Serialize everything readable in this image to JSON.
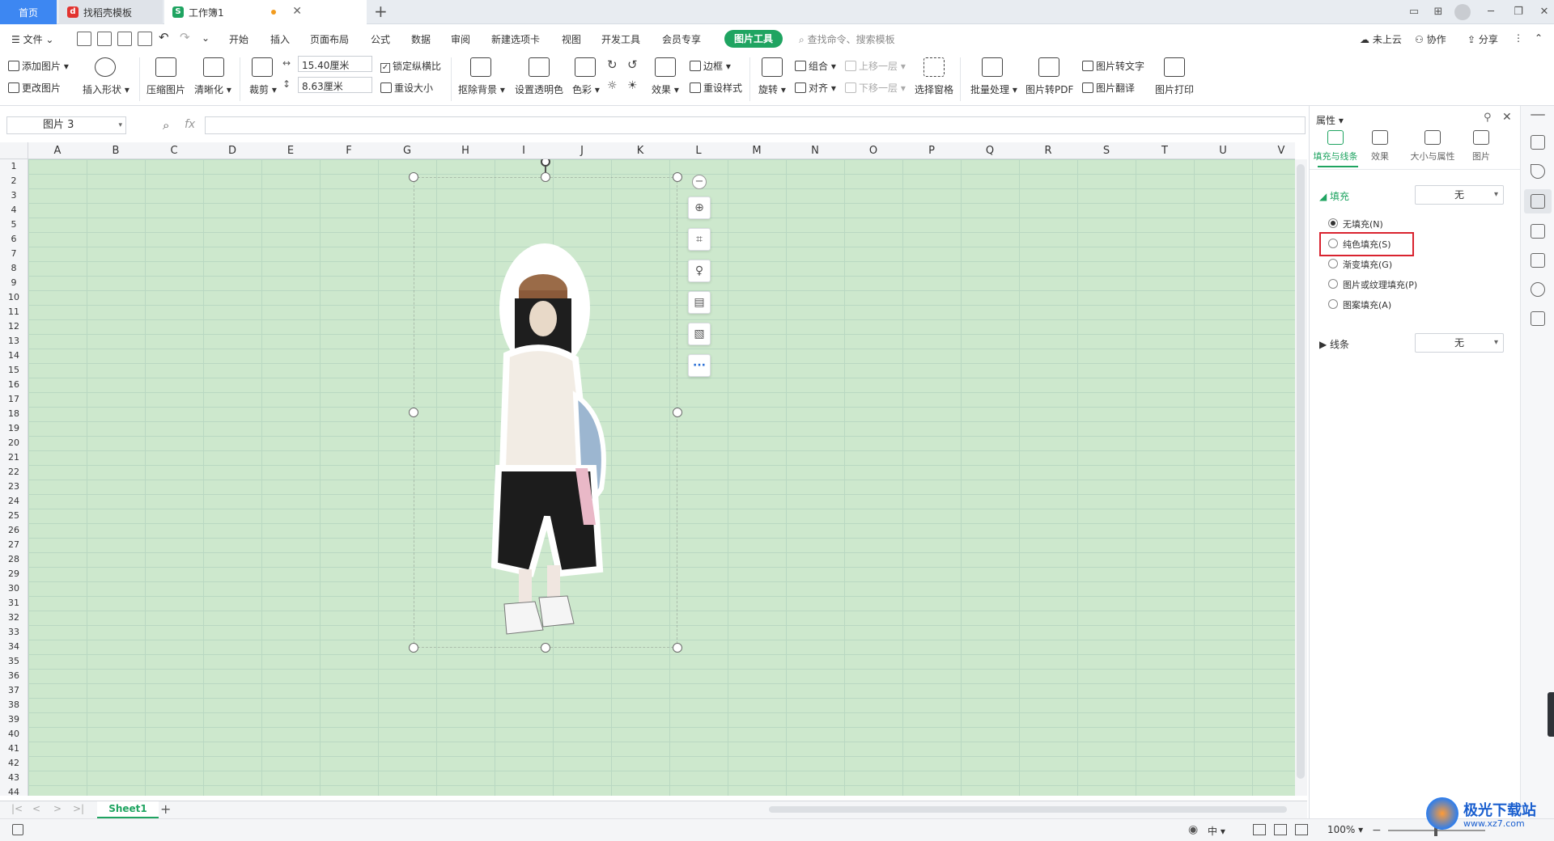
{
  "tabs": {
    "home": "首页",
    "template": "找稻壳模板",
    "workbook": "工作簿1",
    "add": "+"
  },
  "menu": {
    "file": "文件",
    "items": [
      "开始",
      "插入",
      "页面布局",
      "公式",
      "数据",
      "审阅",
      "新建选项卡",
      "视图",
      "开发工具",
      "会员专享"
    ],
    "active_tool": "图片工具",
    "search_placeholder": "查找命令、搜索模板",
    "cloud": "未上云",
    "collab": "协作",
    "share": "分享"
  },
  "ribbon": {
    "add_picture": "添加图片",
    "change_picture": "更改图片",
    "insert_shape": "插入形状",
    "compress": "压缩图片",
    "sharpen": "清晰化",
    "crop": "裁剪",
    "width": "15.40厘米",
    "height": "8.63厘米",
    "lock_ratio": "锁定纵横比",
    "reset_size": "重设大小",
    "remove_bg": "抠除背景",
    "set_transparent": "设置透明色",
    "color": "色彩",
    "effects": "效果",
    "border": "边框",
    "reset_style": "重设样式",
    "rotate": "旋转",
    "group": "组合",
    "align": "对齐",
    "bring_forward": "上移一层",
    "send_backward": "下移一层",
    "selection_pane": "选择窗格",
    "batch": "批量处理",
    "to_pdf": "图片转PDF",
    "to_text": "图片转文字",
    "translate": "图片翻译",
    "print": "图片打印"
  },
  "formula": {
    "name_box": "图片 3",
    "fx": "fx",
    "value": ""
  },
  "columns": [
    "A",
    "B",
    "C",
    "D",
    "E",
    "F",
    "G",
    "H",
    "I",
    "J",
    "K",
    "L",
    "M",
    "N",
    "O",
    "P",
    "Q",
    "R",
    "S",
    "T",
    "U",
    "V"
  ],
  "row_count": 44,
  "sheet_tab": "Sheet1",
  "status": {
    "zoom": "100%",
    "ime": "中"
  },
  "panel": {
    "title": "属性",
    "tabs": [
      "填充与线条",
      "效果",
      "大小与属性",
      "图片"
    ],
    "fill_label": "填充",
    "fill_value": "无",
    "options": [
      "无填充(N)",
      "纯色填充(S)",
      "渐变填充(G)",
      "图片或纹理填充(P)",
      "图案填充(A)"
    ],
    "selected_option": "无填充(N)",
    "highlighted_option": "纯色填充(S)",
    "line_label": "线条",
    "line_value": "无"
  },
  "watermark": {
    "text": "极光下载站",
    "url": "www.xz7.com"
  },
  "colors": {
    "accent": "#1fa461",
    "tab_blue": "#3d87f2",
    "grid_bg": "#cde8cd",
    "highlight": "#d9232f"
  }
}
